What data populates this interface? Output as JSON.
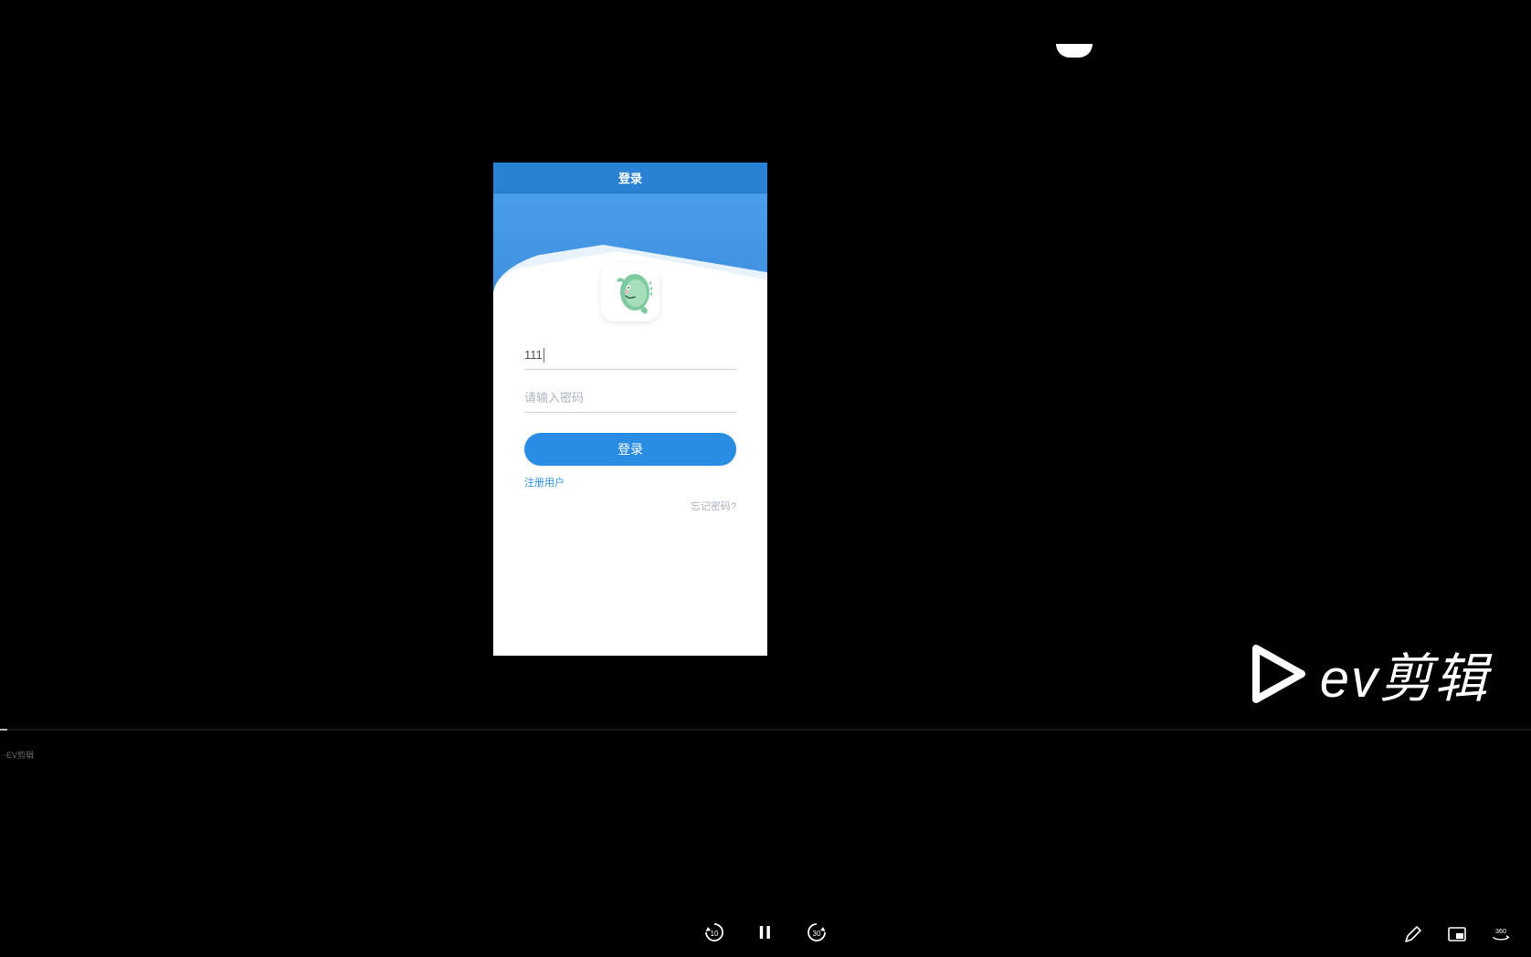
{
  "login": {
    "title": "登录",
    "username_value": "111",
    "password_placeholder": "请输入密码",
    "button_label": "登录",
    "register_label": "注册用户",
    "forgot_label": "忘记密码?"
  },
  "watermark": {
    "text": "ev剪辑"
  },
  "player": {
    "tiny_label": "-EV剪辑",
    "skip_back_seconds": "10",
    "skip_forward_seconds": "30",
    "vr_label": "360"
  }
}
